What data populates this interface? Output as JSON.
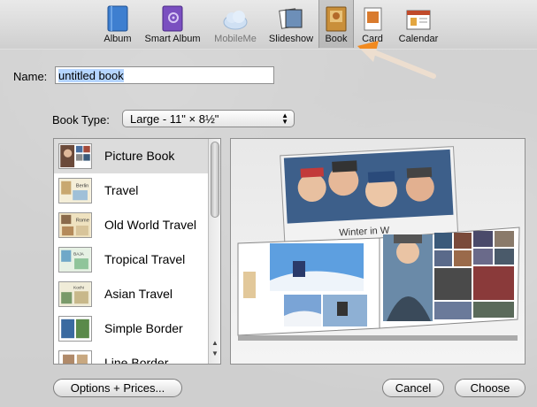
{
  "toolbar": {
    "items": [
      {
        "label": "Album",
        "icon": "album-icon"
      },
      {
        "label": "Smart Album",
        "icon": "smart-album-icon"
      },
      {
        "label": "MobileMe",
        "icon": "mobileme-cloud-icon"
      },
      {
        "label": "Slideshow",
        "icon": "slideshow-icon"
      },
      {
        "label": "Book",
        "icon": "book-icon"
      },
      {
        "label": "Card",
        "icon": "card-icon"
      },
      {
        "label": "Calendar",
        "icon": "calendar-icon"
      }
    ],
    "selected": "Book"
  },
  "form": {
    "name_label": "Name:",
    "name_value": "untitled book",
    "book_type_label": "Book Type:",
    "book_type_value": "Large - 11\" × 8½\""
  },
  "themes": [
    {
      "label": "Picture Book",
      "selected": true
    },
    {
      "label": "Travel"
    },
    {
      "label": "Old World Travel"
    },
    {
      "label": "Tropical Travel"
    },
    {
      "label": "Asian Travel"
    },
    {
      "label": "Simple Border"
    },
    {
      "label": "Line Border"
    }
  ],
  "thumb_text": {
    "travel": "Berlin",
    "old_world": "Rome",
    "tropical": "BAJA",
    "asian": "Kochi"
  },
  "preview": {
    "caption": "Winter in W"
  },
  "buttons": {
    "options": "Options + Prices...",
    "cancel": "Cancel",
    "choose": "Choose"
  },
  "colors": {
    "arrow": "#f28a1f",
    "selection": "#b5d5ff"
  }
}
